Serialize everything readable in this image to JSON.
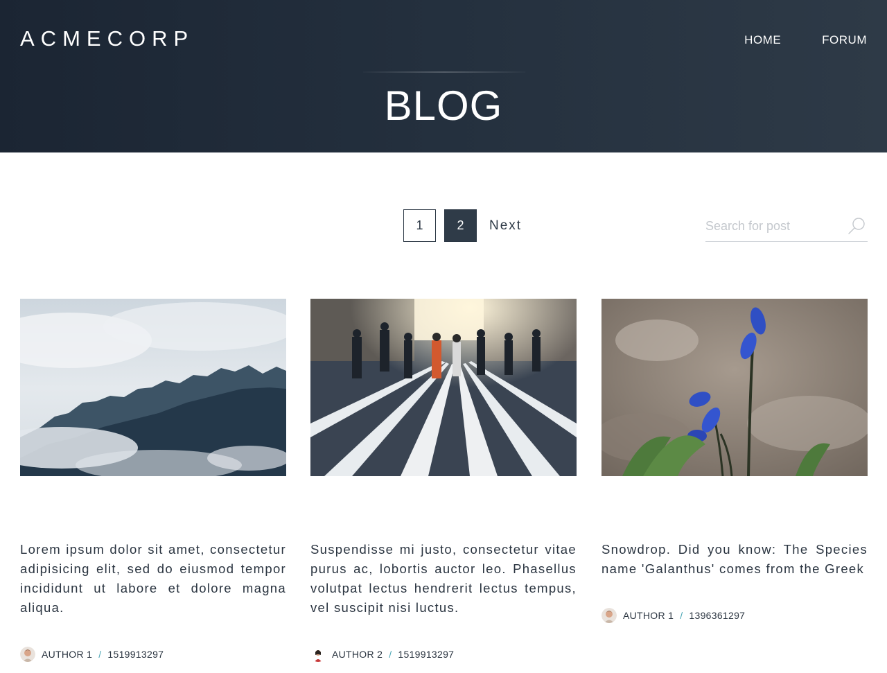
{
  "header": {
    "brand": "ACMECORP",
    "nav": [
      {
        "label": "HOME"
      },
      {
        "label": "FORUM"
      }
    ],
    "page_title": "BLOG"
  },
  "pagination": {
    "pages": [
      "1",
      "2"
    ],
    "current": "2",
    "next_label": "Next"
  },
  "search": {
    "placeholder": "Search for post",
    "value": ""
  },
  "posts": [
    {
      "image": "misty-forest-photo",
      "text": "Lorem ipsum dolor sit amet, consectetur adipisicing elit, sed do eiusmod tempor incididunt ut labore et dolore magna aliqua.",
      "author": "AUTHOR 1",
      "separator": "/",
      "timestamp": "1519913297"
    },
    {
      "image": "crosswalk-crowd-photo",
      "text": "Suspendisse mi justo, consectetur vitae purus ac, lobortis auctor leo. Phasellus volutpat lectus hendrerit lectus tempus, vel suscipit nisi luctus.",
      "author": "AUTHOR 2",
      "separator": "/",
      "timestamp": "1519913297"
    },
    {
      "image": "snowdrop-flower-photo",
      "text": "Snowdrop. Did you know: The Species name 'Galanthus' comes from the Greek",
      "author": "AUTHOR 1",
      "separator": "/",
      "timestamp": "1396361297"
    }
  ],
  "colors": {
    "header_bg": "#1b2533",
    "active_page": "#2f3b48",
    "separator_accent": "#4aa6b5"
  }
}
